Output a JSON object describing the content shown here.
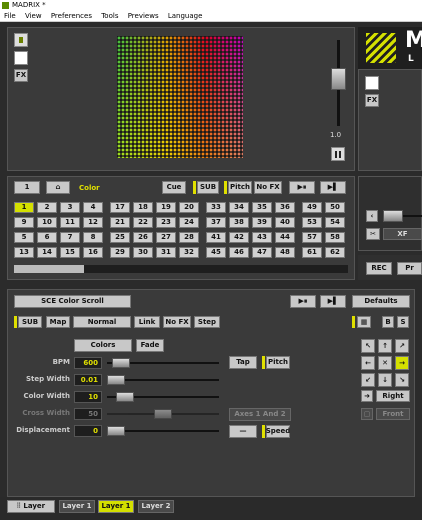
{
  "window": {
    "title": "MADRIX *",
    "menu": [
      "File",
      "View",
      "Preferences",
      "Tools",
      "Previews",
      "Language"
    ]
  },
  "preview": {
    "fx_label": "FX",
    "fader_value": "1.0",
    "logo": "M",
    "logo_sub": "L"
  },
  "right": {
    "fx_label": "FX",
    "xf_label": "XF",
    "rec_label": "REC",
    "pr_label": "Pr"
  },
  "storage": {
    "page_num": "1",
    "place_label": "Color",
    "cue": "Cue",
    "sub": "SUB",
    "pitch": "Pitch",
    "nofx": "No FX",
    "selected": "1",
    "groups": [
      [
        "1",
        "2",
        "3",
        "4",
        "9",
        "10",
        "11",
        "12",
        "5",
        "6",
        "7",
        "8",
        "13",
        "14",
        "15",
        "16"
      ],
      [
        "17",
        "18",
        "19",
        "20",
        "21",
        "22",
        "23",
        "24",
        "25",
        "26",
        "27",
        "28",
        "29",
        "30",
        "31",
        "32"
      ],
      [
        "33",
        "34",
        "35",
        "36",
        "37",
        "38",
        "39",
        "40",
        "41",
        "42",
        "43",
        "44",
        "45",
        "46",
        "47",
        "48"
      ],
      [
        "49",
        "50",
        "53",
        "54",
        "57",
        "58",
        "61",
        "62"
      ]
    ]
  },
  "effect": {
    "name": "SCE Color Scroll",
    "defaults": "Defaults",
    "sub": "SUB",
    "map": "Map",
    "normal": "Normal",
    "link": "Link",
    "nofx": "No FX",
    "step": "Step",
    "b": "B",
    "s": "S",
    "colors": "Colors",
    "fade": "Fade",
    "tap": "Tap",
    "pitch": "Pitch",
    "axes": "Axes 1 And 2",
    "speed": "Speed",
    "right": "Right",
    "front": "Front",
    "params": [
      {
        "label": "BPM",
        "value": "600",
        "level": 0.05,
        "dim": false
      },
      {
        "label": "Step Width",
        "value": "0.01",
        "level": 0.0,
        "dim": false
      },
      {
        "label": "Color Width",
        "value": "10",
        "level": 0.1,
        "dim": false
      },
      {
        "label": "Cross Width",
        "value": "50",
        "level": 0.5,
        "dim": true
      },
      {
        "label": "Displacement",
        "value": "0",
        "level": 0.0,
        "dim": false
      }
    ]
  },
  "layers": {
    "label": "Layer",
    "tabs": [
      "Layer 1",
      "Layer 1",
      "Layer 2"
    ],
    "selected": 1
  },
  "colors": {
    "accent": "#d4e000"
  }
}
